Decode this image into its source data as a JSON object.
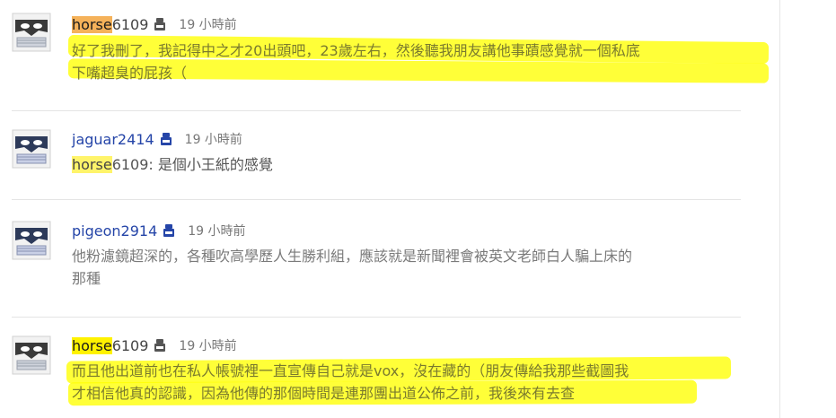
{
  "comments": [
    {
      "user_highlight": "horse",
      "user_rest": "6109",
      "time": "19 小時前",
      "text_line1": "好了我刪了，我記得中之才20出頭吧，23歲左右，然後聽我朋友講他事蹟感覺就一個私底",
      "text_line2": "下嘴超臭的屁孩（"
    },
    {
      "user": "jaguar2414",
      "time": "19 小時前",
      "mention_highlight": "horse",
      "mention_rest": "6109",
      "text": ": 是個小王紙的感覺"
    },
    {
      "user": "pigeon2914",
      "time": "19 小時前",
      "text_line1": "他粉濾鏡超深的，各種吹高學歷人生勝利組，應該就是新聞裡會被英文老師白人騙上床的",
      "text_line2": "那種"
    },
    {
      "user_highlight": "horse",
      "user_rest": "6109",
      "time": "19 小時前",
      "text_line1": "而且他出道前也在私人帳號裡一直宣傳自己就是vox，沒在藏的（朋友傳給我那些截圖我",
      "text_line2": "才相信他真的認識，因為他傳的那個時間是連那團出道公佈之前，我後來有去查"
    }
  ],
  "colors": {
    "marker_yellow": "#ffff00",
    "username_blue": "#2545a8",
    "orange_highlight": "#f5b25a"
  },
  "icons": [
    "mask-avatar",
    "user-badge-icon"
  ]
}
